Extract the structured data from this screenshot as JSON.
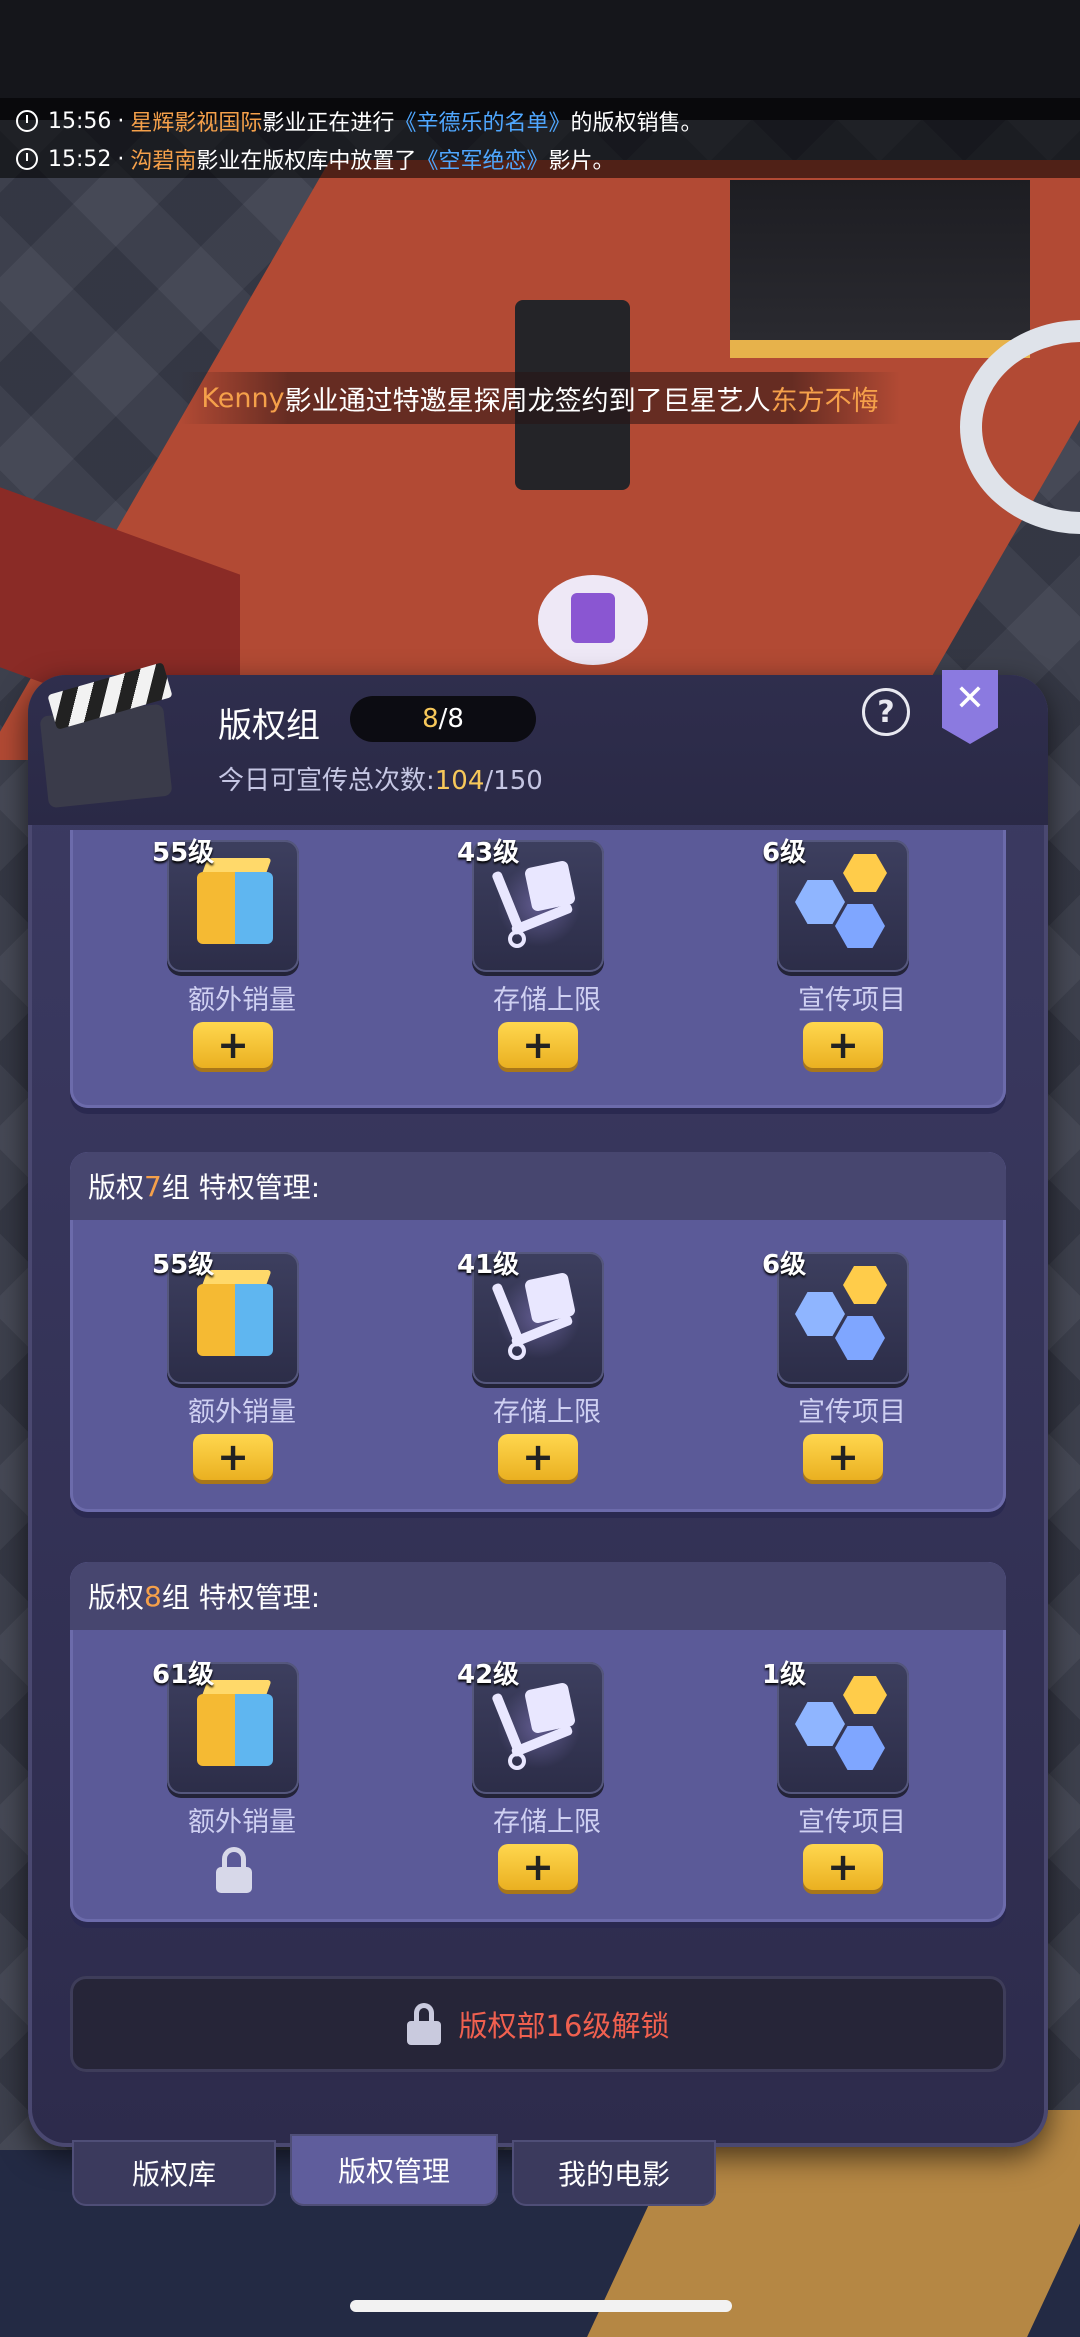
{
  "ticker": {
    "line1": {
      "time": "15:56",
      "sep": "·",
      "studio": "星辉影视国际",
      "mid": "影业正在进行",
      "film": "《辛德乐的名单》",
      "end": "的版权销售。"
    },
    "line2": {
      "time": "15:52",
      "sep": "·",
      "studio": "沟碧南",
      "mid": "影业在版权库中放置了",
      "film": "《空军绝恋》",
      "end": "影片。"
    }
  },
  "announcement": {
    "studio": "Kenny",
    "mid": "影业通过特邀星探周龙签约到了巨星艺人",
    "star": "东方不悔"
  },
  "panel": {
    "title": "版权组",
    "counter": {
      "current": "8",
      "sep": "/",
      "total": "8"
    },
    "promo": {
      "label": "今日可宣传总次数:",
      "used": "104",
      "sep": "/",
      "max": "150"
    },
    "help_glyph": "?",
    "close_glyph": "✕"
  },
  "groups": [
    {
      "slots": [
        {
          "level": "55级",
          "label": "额外销量",
          "action": "+"
        },
        {
          "level": "43级",
          "label": "存储上限",
          "action": "+"
        },
        {
          "level": "6级",
          "label": "宣传项目",
          "action": "+"
        }
      ]
    },
    {
      "title_prefix": "版权",
      "number": "7",
      "title_suffix": "组 特权管理:",
      "slots": [
        {
          "level": "55级",
          "label": "额外销量",
          "action": "+"
        },
        {
          "level": "41级",
          "label": "存储上限",
          "action": "+"
        },
        {
          "level": "6级",
          "label": "宣传项目",
          "action": "+"
        }
      ]
    },
    {
      "title_prefix": "版权",
      "number": "8",
      "title_suffix": "组 特权管理:",
      "slots": [
        {
          "level": "61级",
          "label": "额外销量",
          "action": "locked"
        },
        {
          "level": "42级",
          "label": "存储上限",
          "action": "+"
        },
        {
          "level": "1级",
          "label": "宣传项目",
          "action": "+"
        }
      ]
    }
  ],
  "locked_notice": "版权部16级解锁",
  "tabs": [
    {
      "label": "版权库",
      "active": false
    },
    {
      "label": "版权管理",
      "active": true
    },
    {
      "label": "我的电影",
      "active": false
    }
  ],
  "colors": {
    "accent_gold": "#f7c85a",
    "link_blue": "#4fa7ff",
    "locked_red": "#f0604f",
    "panel": "#5b5a98"
  }
}
